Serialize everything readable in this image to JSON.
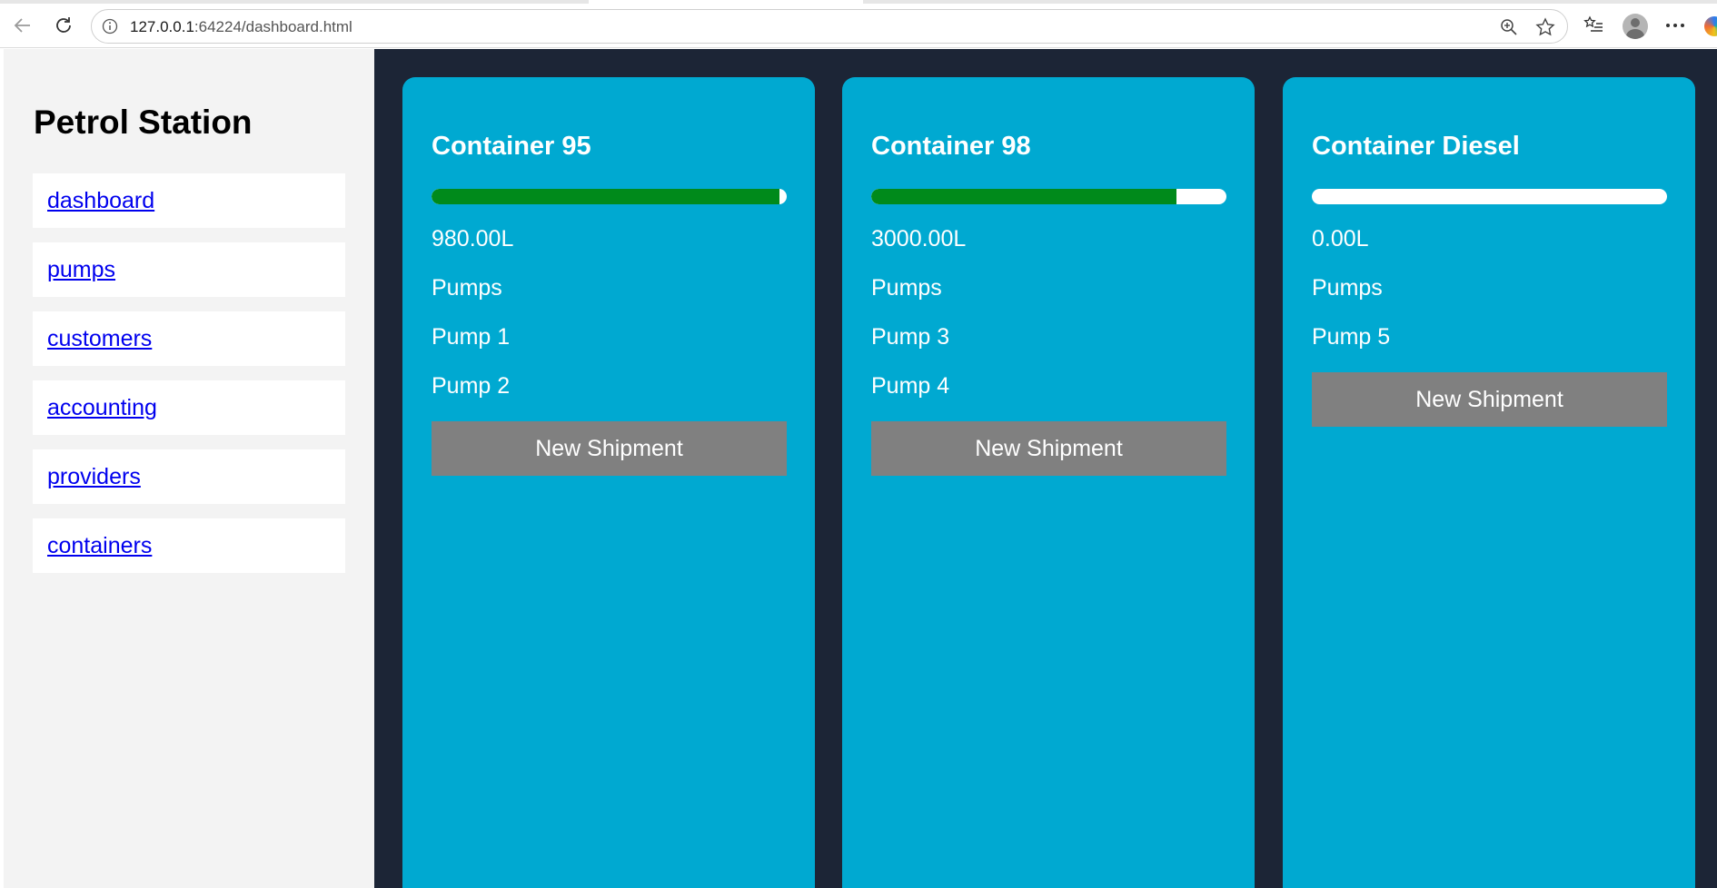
{
  "browser": {
    "url_host": "127.0.0.1",
    "url_rest": ":64224/dashboard.html",
    "icons": {
      "back": "back-arrow-icon",
      "reload": "reload-icon",
      "info": "info-icon",
      "zoom": "zoom-icon",
      "favorite": "star-icon",
      "favorites_list": "favorites-list-icon",
      "profile": "profile-avatar",
      "more": "more-options-icon",
      "copilot": "copilot-icon"
    }
  },
  "sidebar": {
    "title": "Petrol Station",
    "items": [
      {
        "label": "dashboard"
      },
      {
        "label": "pumps"
      },
      {
        "label": "customers"
      },
      {
        "label": "accounting"
      },
      {
        "label": "providers"
      },
      {
        "label": "containers"
      }
    ]
  },
  "containers": [
    {
      "title": "Container 95",
      "level_fraction": 0.98,
      "amount": "980.00L",
      "pumps_label": "Pumps",
      "pumps": [
        "Pump 1",
        "Pump 2"
      ],
      "button_label": "New Shipment"
    },
    {
      "title": "Container 98",
      "level_fraction": 0.86,
      "amount": "3000.00L",
      "pumps_label": "Pumps",
      "pumps": [
        "Pump 3",
        "Pump 4"
      ],
      "button_label": "New Shipment"
    },
    {
      "title": "Container Diesel",
      "level_fraction": 0.0,
      "amount": "0.00L",
      "pumps_label": "Pumps",
      "pumps": [
        "Pump 5"
      ],
      "button_label": "New Shipment"
    }
  ],
  "colors": {
    "main_background": "#1c2536",
    "card_background": "#00a9d1",
    "level_fill": "#008a1b",
    "button_background": "#808080",
    "link": "#0000ee"
  }
}
